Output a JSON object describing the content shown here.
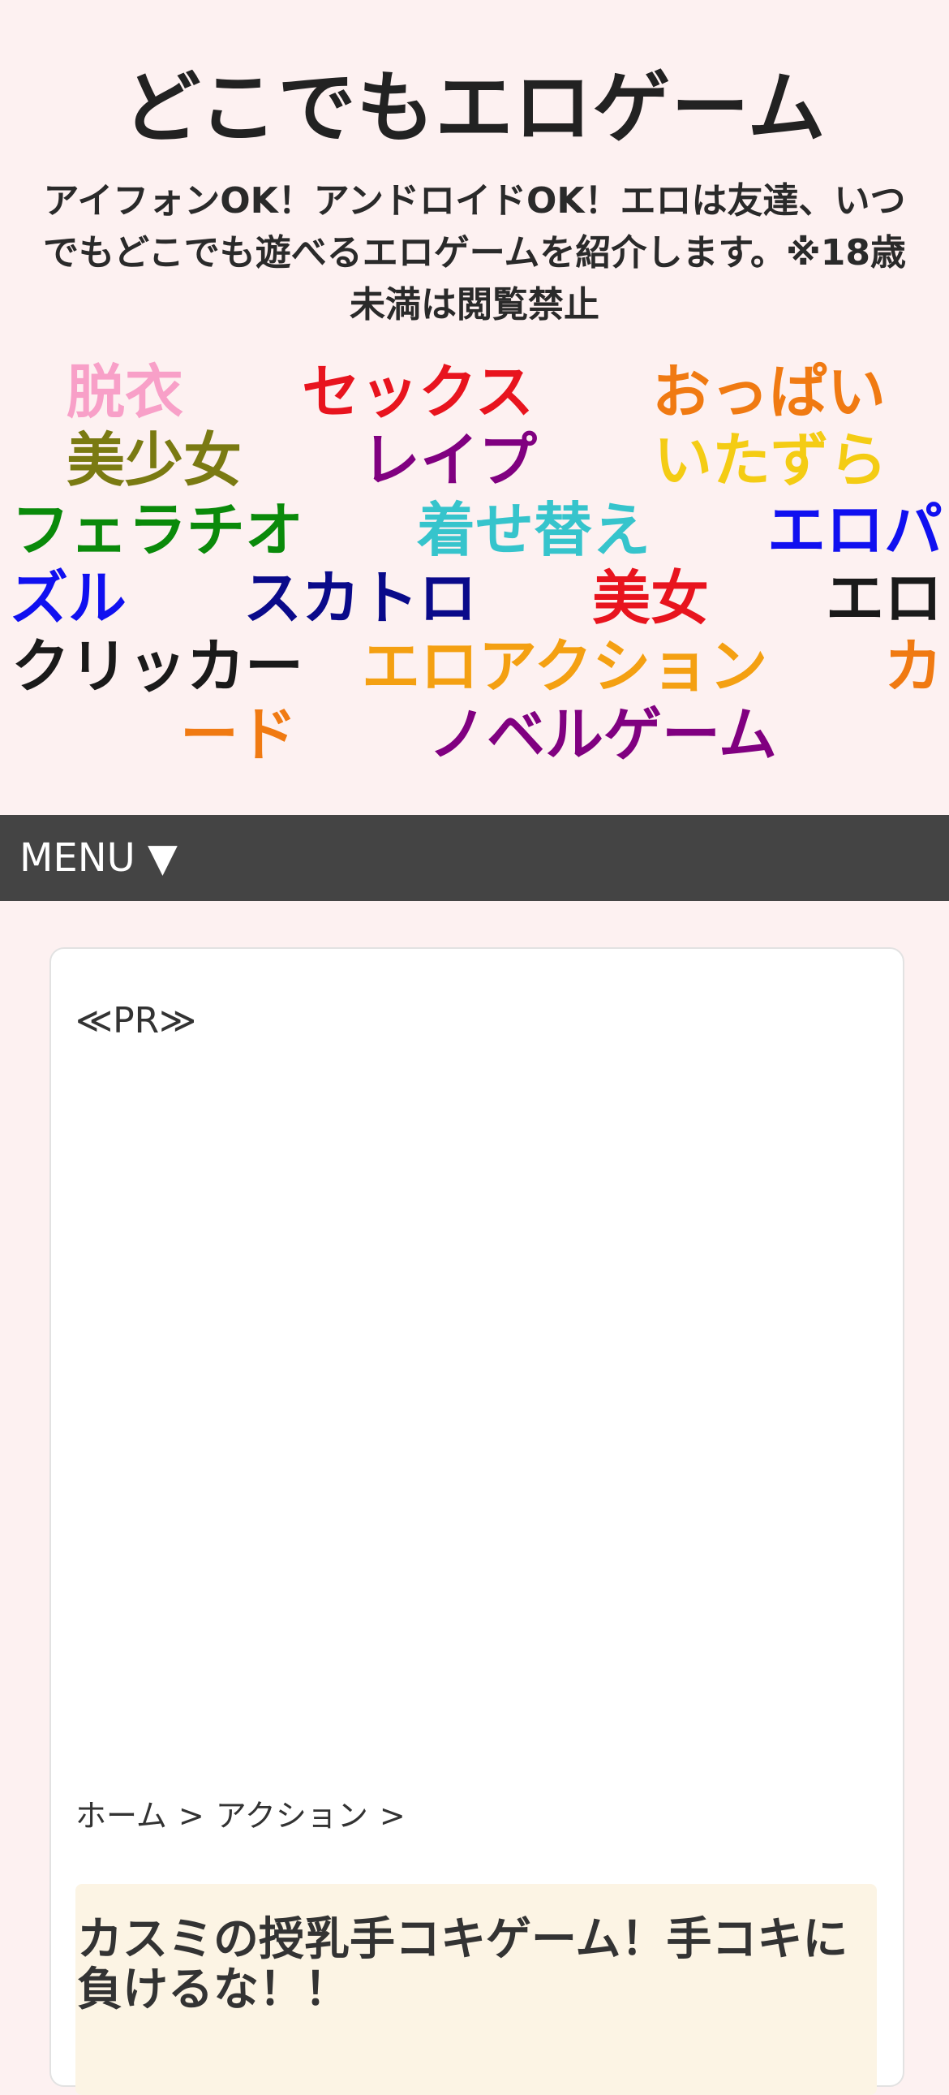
{
  "site": {
    "title": "どこでもエロゲーム",
    "tagline_lines": [
      "アイフォンOK！アンドロイドOK！エロは友達、いつ",
      "でもどこでも遊べるエロゲームを紹介します。※18歳",
      "未満は閲覧禁止"
    ]
  },
  "categories": [
    {
      "label": "脱衣",
      "color": "#f8a0c8"
    },
    {
      "label": "セックス",
      "color": "#e8141e"
    },
    {
      "label": "おっぱい",
      "color": "#f07a12"
    },
    {
      "label": "美少女",
      "color": "#7a7a12"
    },
    {
      "label": "レイプ",
      "color": "#800080"
    },
    {
      "label": "いたずら",
      "color": "#f4cc14"
    },
    {
      "label": "フェラチオ",
      "color": "#0a8a0a"
    },
    {
      "label": "着せ替え",
      "color": "#36c4cc"
    },
    {
      "label": "エロパ",
      "color": "#1010f0"
    },
    {
      "label": "ズル",
      "color": "#1010f0"
    },
    {
      "label": "スカトロ",
      "color": "#0a0a8a"
    },
    {
      "label": "美女",
      "color": "#e8141e"
    },
    {
      "label": "エロ",
      "color": "#1a1a1a"
    },
    {
      "label": "クリッカー",
      "color": "#1a1a1a"
    },
    {
      "label": "エロアクション",
      "color": "#f4a012"
    },
    {
      "label": "カ",
      "color": "#f07a12"
    },
    {
      "label": "ード",
      "color": "#f07a12"
    },
    {
      "label": "ノベルゲーム",
      "color": "#800080"
    }
  ],
  "menu": {
    "label": "MENU ▼"
  },
  "article": {
    "pr_label": "≪PR≫",
    "breadcrumb": [
      {
        "label": "ホーム"
      },
      {
        "label": "アクション"
      }
    ],
    "breadcrumb_sep": ">",
    "title": "カスミの授乳手コキゲーム！手コキに負けるな！！"
  }
}
